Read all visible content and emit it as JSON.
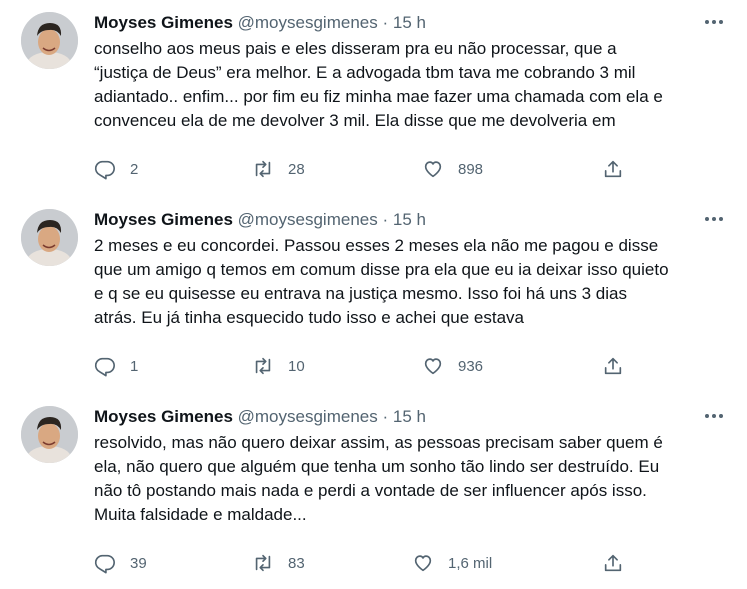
{
  "tweets": [
    {
      "name": "Moyses Gimenes",
      "handle": "@moysesgimenes",
      "dot": "·",
      "time": "15 h",
      "lines": [
        "conselho aos meus pais e eles disseram pra eu não processar, que a",
        "“justiça de Deus” era melhor. E a advogada tbm tava me cobrando 3 mil",
        "adiantado.. enfim... por fim eu fiz minha mae fazer uma chamada com ela e",
        "convenceu ela de me devolver 3 mil. Ela disse que me devolveria em"
      ],
      "replies": "2",
      "retweets": "28",
      "likes": "898"
    },
    {
      "name": "Moyses Gimenes",
      "handle": "@moysesgimenes",
      "dot": "·",
      "time": "15 h",
      "lines": [
        "2 meses e eu concordei. Passou esses 2 meses ela não me pagou e disse",
        "que um amigo q temos em comum disse pra ela que eu ia deixar isso quieto",
        "e q se eu quisesse eu entrava na justiça mesmo. Isso foi há uns 3 dias",
        "atrás. Eu já tinha esquecido tudo isso e achei que estava"
      ],
      "replies": "1",
      "retweets": "10",
      "likes": "936"
    },
    {
      "name": "Moyses Gimenes",
      "handle": "@moysesgimenes",
      "dot": "·",
      "time": "15 h",
      "lines": [
        "resolvido, mas não quero deixar assim, as pessoas precisam saber quem é",
        "ela, não quero que alguém que tenha um sonho tão lindo ser destruído. Eu",
        "não tô postando mais nada e perdi a vontade de ser influencer após isso.",
        "Muita falsidade e maldade..."
      ],
      "replies": "39",
      "retweets": "83",
      "likes": "1,6 mil"
    }
  ],
  "icons": {
    "reply": "reply-icon",
    "retweet": "retweet-icon",
    "like": "heart-icon",
    "share": "share-icon",
    "more": "more-icon",
    "avatar": "avatar"
  },
  "colors": {
    "text": "#0f1419",
    "secondary": "#536471",
    "background": "#ffffff"
  }
}
